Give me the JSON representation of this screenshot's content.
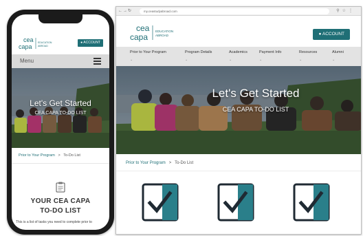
{
  "brand": {
    "name_line1": "cea",
    "name_line2": "capa",
    "tagline_line1": "EDUCATION",
    "tagline_line2": "ABROAD",
    "accent_color": "#1f6f76"
  },
  "mobile": {
    "account_label": "ACCOUNT",
    "menu_label": "Menu",
    "hero_title": "Let's Get Started",
    "hero_subtitle": "CEA CAPA TO-DO LIST",
    "breadcrumb": {
      "parent": "Prior to Your Program",
      "separator": ">",
      "current": "To-Do List"
    },
    "page_title_line1": "YOUR CEA CAPA",
    "page_title_line2": "TO-DO LIST",
    "description": "This is a list of tasks you need to complete prior to"
  },
  "desktop": {
    "url": "my.ceastudyabroad.com",
    "account_label": "ACCOUNT",
    "nav": [
      "Prior to Your Program",
      "Program Details",
      "Academics",
      "Payment Info",
      "Resources",
      "Alumni"
    ],
    "hero_title": "Let's Get Started",
    "hero_subtitle": "CEA CAPA TO-DO LIST",
    "breadcrumb": {
      "parent": "Prior to Your Program",
      "separator": ">",
      "current": "To-Do List"
    },
    "checklist_icon_count": 3
  }
}
